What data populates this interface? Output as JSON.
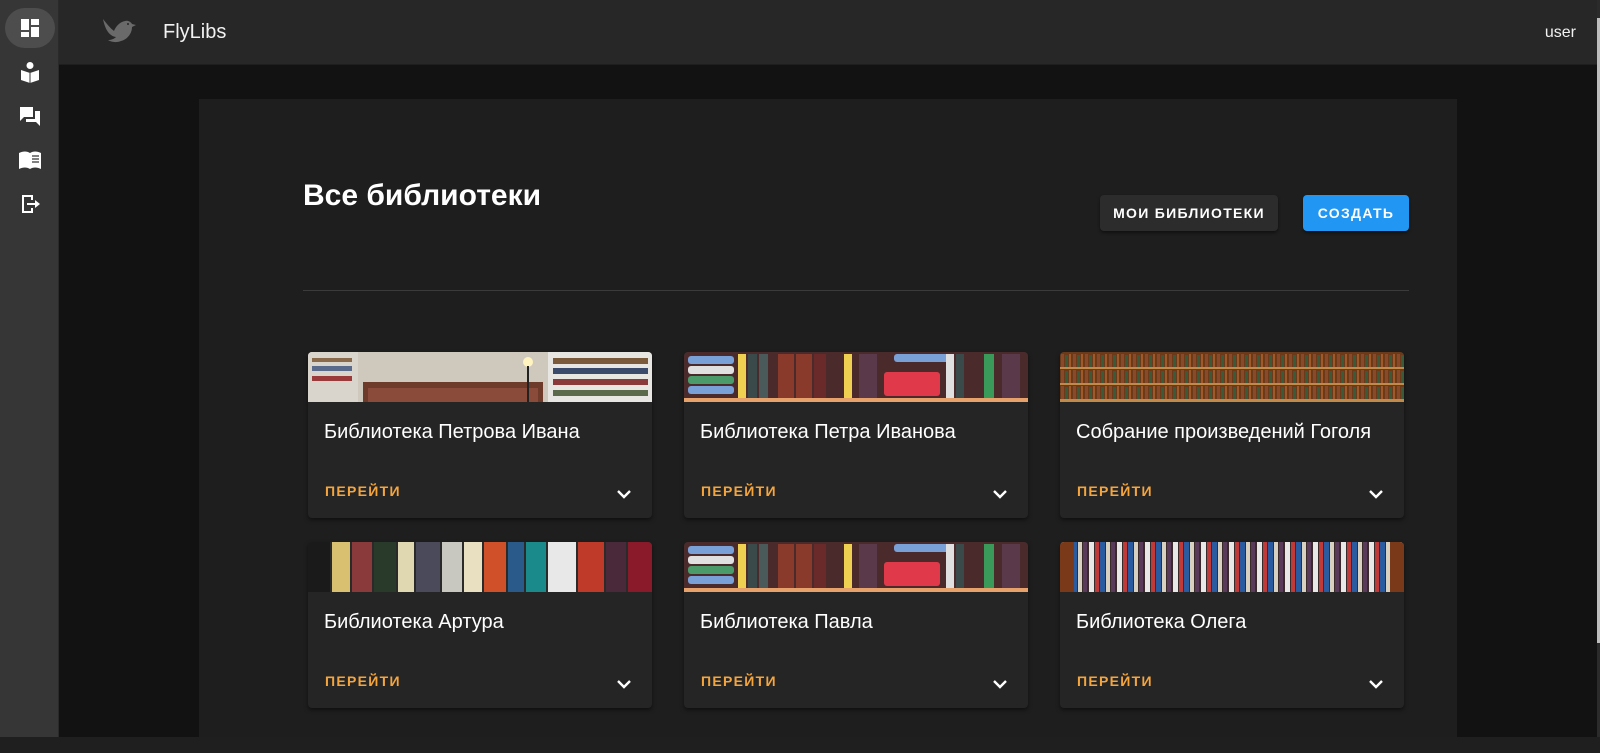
{
  "app": {
    "title": "FlyLibs",
    "user": "user"
  },
  "sidebar": {
    "items": [
      {
        "icon": "dashboard-icon",
        "active": true
      },
      {
        "icon": "book-reader-icon",
        "active": false
      },
      {
        "icon": "forum-icon",
        "active": false
      },
      {
        "icon": "open-book-icon",
        "active": false
      },
      {
        "icon": "logout-icon",
        "active": false
      }
    ]
  },
  "page": {
    "title": "Все библиотеки",
    "my_libraries_label": "МОИ БИБЛИОТЕКИ",
    "create_label": "СОЗДАТЬ"
  },
  "libraries": [
    {
      "title": "Библиотека Петрова Ивана",
      "action": "ПЕРЕЙТИ"
    },
    {
      "title": "Библиотека Петра Иванова",
      "action": "ПЕРЕЙТИ"
    },
    {
      "title": "Собрание произведений Гоголя",
      "action": "ПЕРЕЙТИ"
    },
    {
      "title": "Библиотека Артура",
      "action": "ПЕРЕЙТИ"
    },
    {
      "title": "Библиотека Павла",
      "action": "ПЕРЕЙТИ"
    },
    {
      "title": "Библиотека Олега",
      "action": "ПЕРЕЙТИ"
    }
  ],
  "colors": {
    "accent": "#f5a53b",
    "primary": "#2196f3",
    "card": "#252525",
    "panel": "#1e1e1e"
  }
}
